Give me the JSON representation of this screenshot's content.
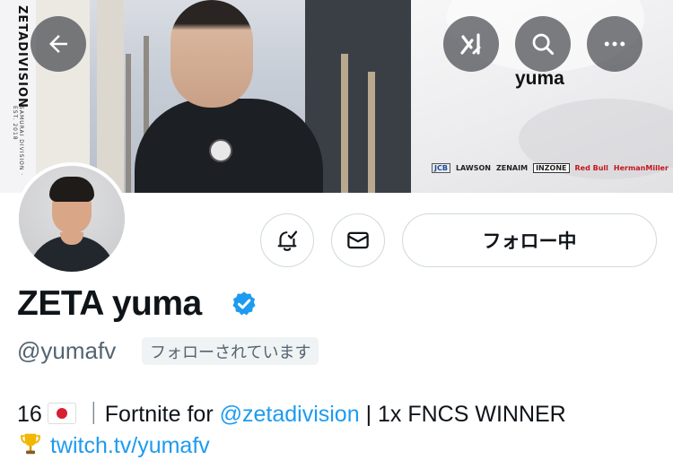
{
  "banner": {
    "brand_vertical": "ZETADIVISION",
    "brand_small": "SAMURAI DIVISION · EST. 2018",
    "name": "yuma",
    "sponsors": [
      "JCB",
      "LAWSON",
      "ZENAIM",
      "INZONE",
      "Red Bull",
      "HermanMiller"
    ]
  },
  "overlay": {
    "back_icon": "arrow-left-icon",
    "grok_icon": "grok-icon",
    "search_icon": "search-icon",
    "more_icon": "more-horizontal-icon"
  },
  "actions": {
    "notify_icon": "bell-check-icon",
    "message_icon": "envelope-icon",
    "follow_label": "フォロー中"
  },
  "profile": {
    "display_name": "ZETA yuma",
    "verified_icon": "verified-badge-icon",
    "handle": "@yumafv",
    "follows_you": "フォローされています",
    "bio": {
      "age": "16",
      "sep1": "｜",
      "text_before_mention": "Fortnite for ",
      "mention": "@zetadivision",
      "text_after_mention": " | 1x FNCS WINNER",
      "link": "twitch.tv/yumafv"
    }
  },
  "colors": {
    "accent": "#1d9bf0",
    "text_primary": "#0f1419",
    "text_secondary": "#536471",
    "border": "#cfd9de",
    "badge_bg": "#eff3f4"
  }
}
